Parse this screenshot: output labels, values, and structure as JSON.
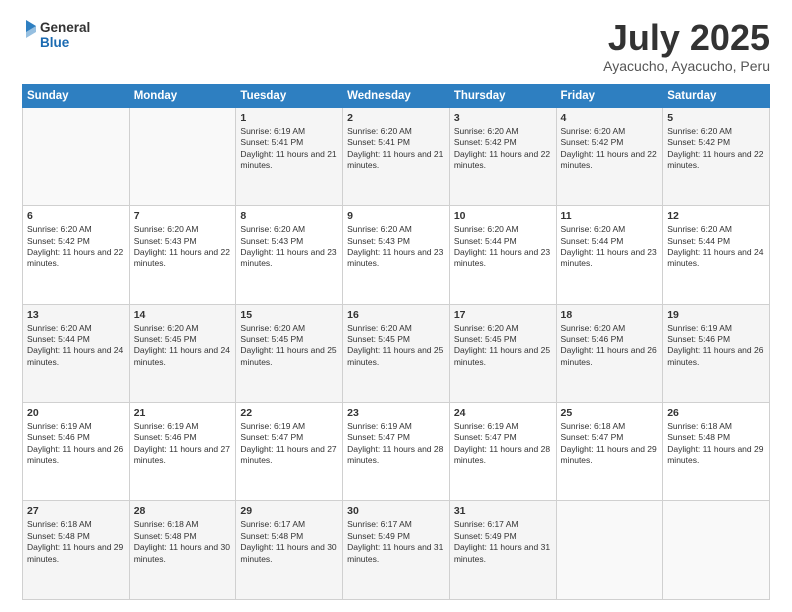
{
  "header": {
    "logo_line1": "General",
    "logo_line2": "Blue",
    "month_title": "July 2025",
    "subtitle": "Ayacucho, Ayacucho, Peru"
  },
  "weekdays": [
    "Sunday",
    "Monday",
    "Tuesday",
    "Wednesday",
    "Thursday",
    "Friday",
    "Saturday"
  ],
  "weeks": [
    [
      {
        "day": "",
        "info": ""
      },
      {
        "day": "",
        "info": ""
      },
      {
        "day": "1",
        "info": "Sunrise: 6:19 AM\nSunset: 5:41 PM\nDaylight: 11 hours and 21 minutes."
      },
      {
        "day": "2",
        "info": "Sunrise: 6:20 AM\nSunset: 5:41 PM\nDaylight: 11 hours and 21 minutes."
      },
      {
        "day": "3",
        "info": "Sunrise: 6:20 AM\nSunset: 5:42 PM\nDaylight: 11 hours and 22 minutes."
      },
      {
        "day": "4",
        "info": "Sunrise: 6:20 AM\nSunset: 5:42 PM\nDaylight: 11 hours and 22 minutes."
      },
      {
        "day": "5",
        "info": "Sunrise: 6:20 AM\nSunset: 5:42 PM\nDaylight: 11 hours and 22 minutes."
      }
    ],
    [
      {
        "day": "6",
        "info": "Sunrise: 6:20 AM\nSunset: 5:42 PM\nDaylight: 11 hours and 22 minutes."
      },
      {
        "day": "7",
        "info": "Sunrise: 6:20 AM\nSunset: 5:43 PM\nDaylight: 11 hours and 22 minutes."
      },
      {
        "day": "8",
        "info": "Sunrise: 6:20 AM\nSunset: 5:43 PM\nDaylight: 11 hours and 23 minutes."
      },
      {
        "day": "9",
        "info": "Sunrise: 6:20 AM\nSunset: 5:43 PM\nDaylight: 11 hours and 23 minutes."
      },
      {
        "day": "10",
        "info": "Sunrise: 6:20 AM\nSunset: 5:44 PM\nDaylight: 11 hours and 23 minutes."
      },
      {
        "day": "11",
        "info": "Sunrise: 6:20 AM\nSunset: 5:44 PM\nDaylight: 11 hours and 23 minutes."
      },
      {
        "day": "12",
        "info": "Sunrise: 6:20 AM\nSunset: 5:44 PM\nDaylight: 11 hours and 24 minutes."
      }
    ],
    [
      {
        "day": "13",
        "info": "Sunrise: 6:20 AM\nSunset: 5:44 PM\nDaylight: 11 hours and 24 minutes."
      },
      {
        "day": "14",
        "info": "Sunrise: 6:20 AM\nSunset: 5:45 PM\nDaylight: 11 hours and 24 minutes."
      },
      {
        "day": "15",
        "info": "Sunrise: 6:20 AM\nSunset: 5:45 PM\nDaylight: 11 hours and 25 minutes."
      },
      {
        "day": "16",
        "info": "Sunrise: 6:20 AM\nSunset: 5:45 PM\nDaylight: 11 hours and 25 minutes."
      },
      {
        "day": "17",
        "info": "Sunrise: 6:20 AM\nSunset: 5:45 PM\nDaylight: 11 hours and 25 minutes."
      },
      {
        "day": "18",
        "info": "Sunrise: 6:20 AM\nSunset: 5:46 PM\nDaylight: 11 hours and 26 minutes."
      },
      {
        "day": "19",
        "info": "Sunrise: 6:19 AM\nSunset: 5:46 PM\nDaylight: 11 hours and 26 minutes."
      }
    ],
    [
      {
        "day": "20",
        "info": "Sunrise: 6:19 AM\nSunset: 5:46 PM\nDaylight: 11 hours and 26 minutes."
      },
      {
        "day": "21",
        "info": "Sunrise: 6:19 AM\nSunset: 5:46 PM\nDaylight: 11 hours and 27 minutes."
      },
      {
        "day": "22",
        "info": "Sunrise: 6:19 AM\nSunset: 5:47 PM\nDaylight: 11 hours and 27 minutes."
      },
      {
        "day": "23",
        "info": "Sunrise: 6:19 AM\nSunset: 5:47 PM\nDaylight: 11 hours and 28 minutes."
      },
      {
        "day": "24",
        "info": "Sunrise: 6:19 AM\nSunset: 5:47 PM\nDaylight: 11 hours and 28 minutes."
      },
      {
        "day": "25",
        "info": "Sunrise: 6:18 AM\nSunset: 5:47 PM\nDaylight: 11 hours and 29 minutes."
      },
      {
        "day": "26",
        "info": "Sunrise: 6:18 AM\nSunset: 5:48 PM\nDaylight: 11 hours and 29 minutes."
      }
    ],
    [
      {
        "day": "27",
        "info": "Sunrise: 6:18 AM\nSunset: 5:48 PM\nDaylight: 11 hours and 29 minutes."
      },
      {
        "day": "28",
        "info": "Sunrise: 6:18 AM\nSunset: 5:48 PM\nDaylight: 11 hours and 30 minutes."
      },
      {
        "day": "29",
        "info": "Sunrise: 6:17 AM\nSunset: 5:48 PM\nDaylight: 11 hours and 30 minutes."
      },
      {
        "day": "30",
        "info": "Sunrise: 6:17 AM\nSunset: 5:49 PM\nDaylight: 11 hours and 31 minutes."
      },
      {
        "day": "31",
        "info": "Sunrise: 6:17 AM\nSunset: 5:49 PM\nDaylight: 11 hours and 31 minutes."
      },
      {
        "day": "",
        "info": ""
      },
      {
        "day": "",
        "info": ""
      }
    ]
  ]
}
